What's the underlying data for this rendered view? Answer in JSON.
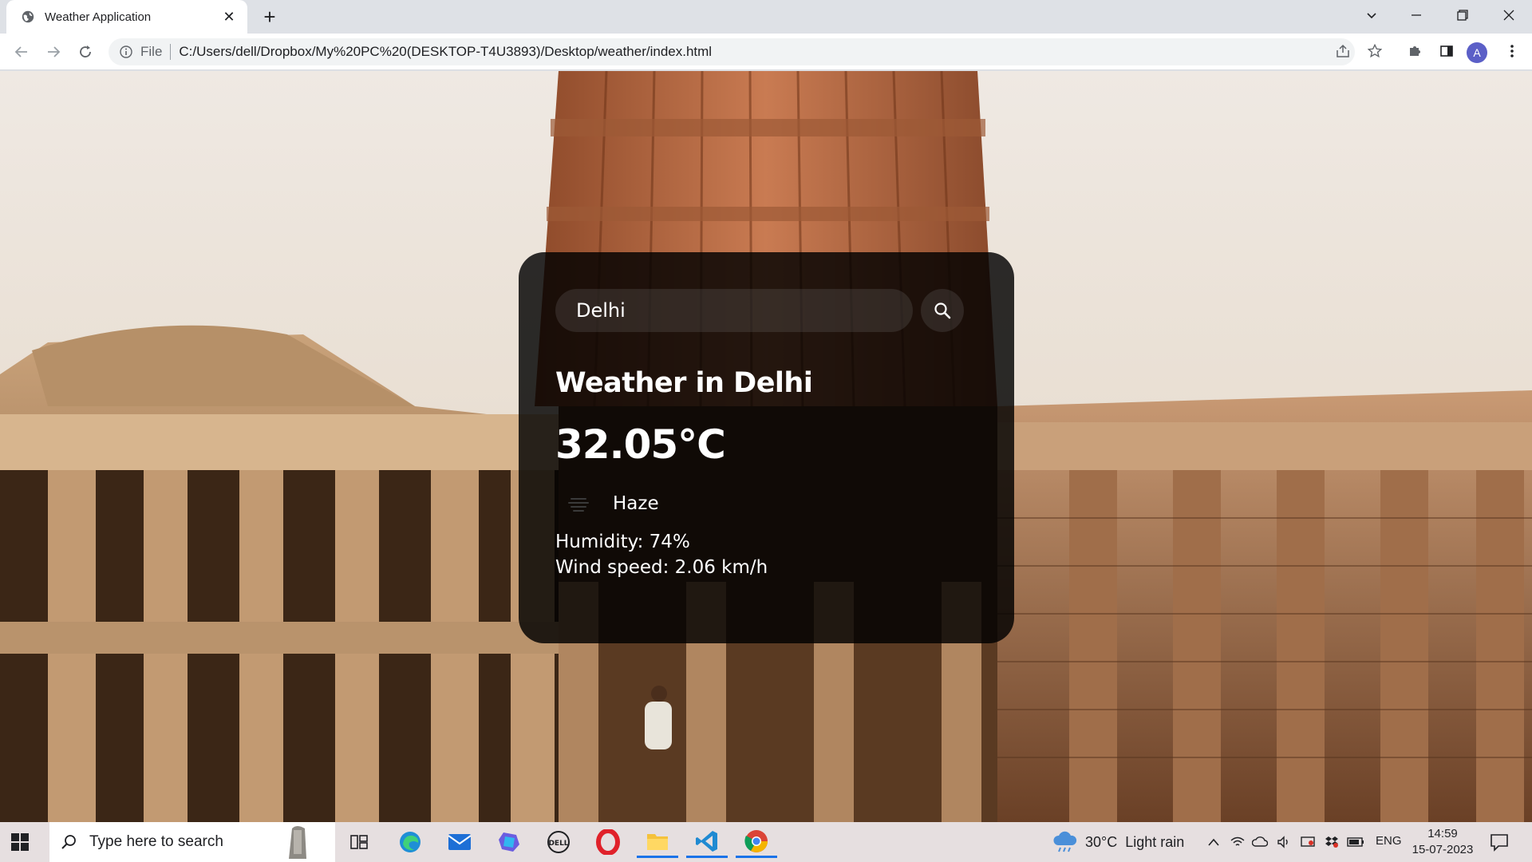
{
  "browser": {
    "tab_title": "Weather Application",
    "url_scheme_label": "File",
    "url": "C:/Users/dell/Dropbox/My%20PC%20(DESKTOP-T4U3893)/Desktop/weather/index.html",
    "profile_initial": "A"
  },
  "weather_card": {
    "search_value": "Delhi",
    "city_heading": "Weather in Delhi",
    "temperature": "32.05°C",
    "description": "Haze",
    "humidity": "Humidity: 74%",
    "wind": "Wind speed: 2.06 km/h"
  },
  "taskbar": {
    "search_placeholder": "Type here to search",
    "weather_widget": "30°C  Light rain",
    "language": "ENG",
    "time": "14:59",
    "date": "15-07-2023"
  },
  "colors": {
    "accent": "#1a73e8",
    "card_background": "#000000"
  }
}
